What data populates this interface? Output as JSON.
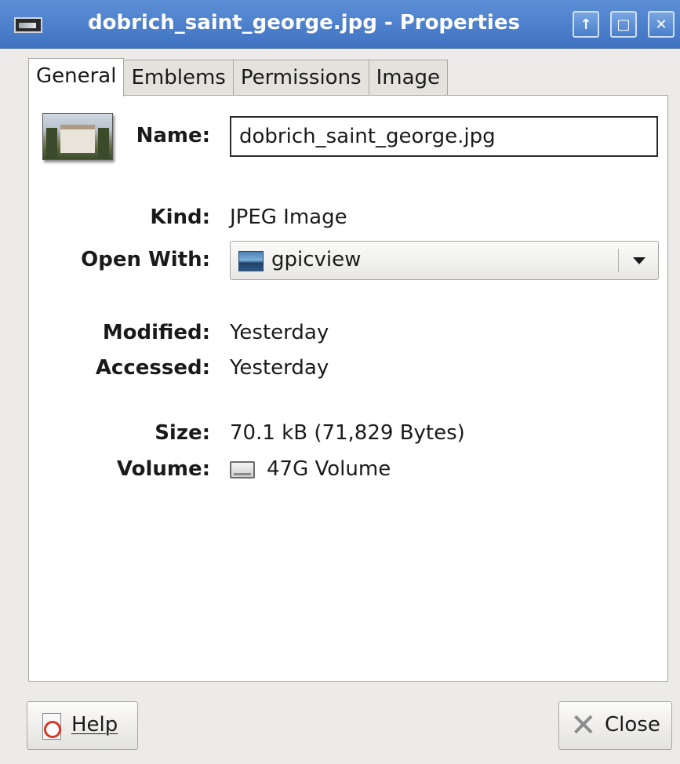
{
  "window": {
    "title": "dobrich_saint_george.jpg - Properties",
    "buttons": {
      "up": "↑",
      "maximize": "□",
      "close": "✕"
    }
  },
  "tabs": [
    {
      "label": "General",
      "active": true
    },
    {
      "label": "Emblems",
      "active": false
    },
    {
      "label": "Permissions",
      "active": false
    },
    {
      "label": "Image",
      "active": false
    }
  ],
  "general": {
    "name_label": "Name:",
    "name_value": "dobrich_saint_george.jpg",
    "kind_label": "Kind:",
    "kind_value": "JPEG Image",
    "open_with_label": "Open With:",
    "open_with_value": "gpicview",
    "modified_label": "Modified:",
    "modified_value": "Yesterday",
    "accessed_label": "Accessed:",
    "accessed_value": "Yesterday",
    "size_label": "Size:",
    "size_value": "70.1 kB (71,829 Bytes)",
    "volume_label": "Volume:",
    "volume_value": "47G Volume"
  },
  "footer": {
    "help_label": "Help",
    "close_label": "Close"
  },
  "icons": {
    "window": "image-file-icon",
    "thumbnail": "image-thumbnail",
    "app": "gpicview-icon",
    "volume": "drive-icon",
    "help": "help-icon",
    "close": "close-icon"
  },
  "colors": {
    "titlebar": "#3f73c2",
    "background": "#ecebe9",
    "panel": "#ffffff"
  }
}
